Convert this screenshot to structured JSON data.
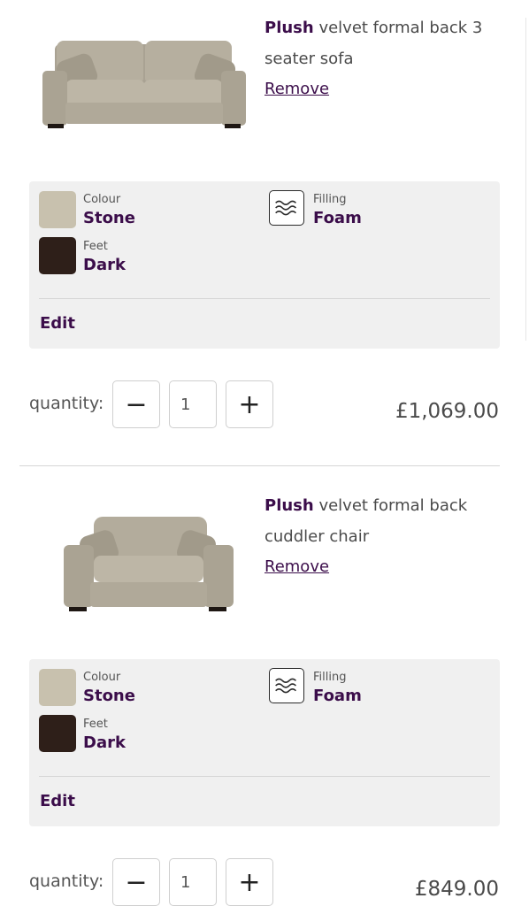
{
  "items": [
    {
      "brand": "Plush",
      "name": "velvet formal back 3 seater sofa",
      "remove_label": "Remove",
      "image_icon": "sofa-image",
      "options": {
        "colour": {
          "label": "Colour",
          "value": "Stone",
          "swatch": "#c8c1ae"
        },
        "feet": {
          "label": "Feet",
          "value": "Dark",
          "swatch": "#2e1f19"
        },
        "filling": {
          "label": "Filling",
          "value": "Foam",
          "icon": "wave-icon"
        },
        "edit_label": "Edit"
      },
      "quantity": {
        "label": "quantity:",
        "value": "1",
        "decrease": "−",
        "increase": "+"
      },
      "price": "£1,069.00"
    },
    {
      "brand": "Plush",
      "name": "velvet formal back cuddler chair",
      "remove_label": "Remove",
      "image_icon": "chair-image",
      "options": {
        "colour": {
          "label": "Colour",
          "value": "Stone",
          "swatch": "#c8c1ae"
        },
        "feet": {
          "label": "Feet",
          "value": "Dark",
          "swatch": "#2e1f19"
        },
        "filling": {
          "label": "Filling",
          "value": "Foam",
          "icon": "wave-icon"
        },
        "edit_label": "Edit"
      },
      "quantity": {
        "label": "quantity:",
        "value": "1",
        "decrease": "−",
        "increase": "+"
      },
      "price": "£849.00"
    }
  ],
  "colors": {
    "accent": "#3b0d4a",
    "panel": "#f0f0f0"
  }
}
